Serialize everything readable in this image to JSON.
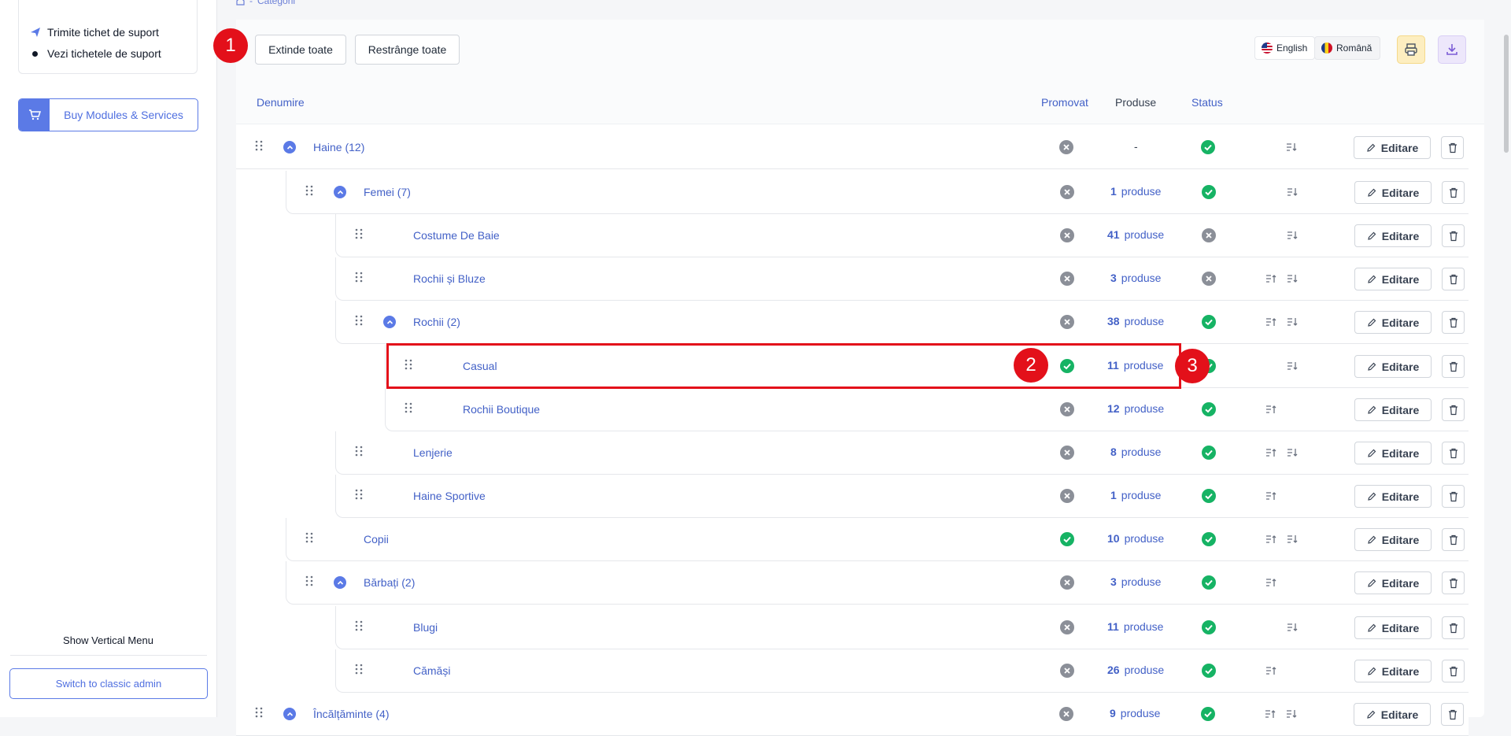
{
  "sidebar": {
    "support_send": "Trimite tichet de suport",
    "support_view": "Vezi tichetele de suport",
    "buy_label": "Buy Modules & Services",
    "show_vertical": "Show Vertical Menu",
    "classic_admin": "Switch to classic admin"
  },
  "breadcrumb": {
    "sep": "-",
    "current": "Categorii"
  },
  "toolbar": {
    "expand_all": "Extinde toate",
    "collapse_all": "Restrânge toate",
    "lang_en": "English",
    "lang_ro": "Română",
    "icons": [
      "printer-icon",
      "download-icon"
    ]
  },
  "table": {
    "headers": {
      "name": "Denumire",
      "promoted": "Promovat",
      "products": "Produse",
      "status": "Status"
    },
    "edit_label": "Editare",
    "products_word": "produse",
    "rows": [
      {
        "name": "Haine (12)",
        "promoted": false,
        "products": "-",
        "status": true,
        "sort": "down",
        "expand": true
      },
      {
        "name": "Femei (7)",
        "promoted": false,
        "products": "1",
        "status": true,
        "sort": "down",
        "expand": true
      },
      {
        "name": "Costume De Baie",
        "promoted": false,
        "products": "41",
        "status": false,
        "sort": "down",
        "expand": false
      },
      {
        "name": "Rochii și Bluze",
        "promoted": false,
        "products": "3",
        "status": false,
        "sort": "both",
        "expand": false
      },
      {
        "name": "Rochii (2)",
        "promoted": false,
        "products": "38",
        "status": true,
        "sort": "both",
        "expand": true
      },
      {
        "name": "Casual",
        "promoted": true,
        "products": "11",
        "status": true,
        "sort": "down",
        "expand": false
      },
      {
        "name": "Rochii Boutique",
        "promoted": false,
        "products": "12",
        "status": true,
        "sort": "up",
        "expand": false
      },
      {
        "name": "Lenjerie",
        "promoted": false,
        "products": "8",
        "status": true,
        "sort": "both",
        "expand": false
      },
      {
        "name": "Haine Sportive",
        "promoted": false,
        "products": "1",
        "status": true,
        "sort": "up",
        "expand": false
      },
      {
        "name": "Copii",
        "promoted": true,
        "products": "10",
        "status": true,
        "sort": "both",
        "expand": false
      },
      {
        "name": "Bărbați (2)",
        "promoted": false,
        "products": "3",
        "status": true,
        "sort": "up",
        "expand": true
      },
      {
        "name": "Blugi",
        "promoted": false,
        "products": "11",
        "status": true,
        "sort": "down",
        "expand": false
      },
      {
        "name": "Cămăși",
        "promoted": false,
        "products": "26",
        "status": true,
        "sort": "up",
        "expand": false
      },
      {
        "name": "Încălțăminte (4)",
        "promoted": false,
        "products": "9",
        "status": true,
        "sort": "both",
        "expand": true
      }
    ]
  },
  "annotations": [
    "1",
    "2",
    "3"
  ],
  "colors": {
    "accent": "#5b7ae6",
    "link": "#4361c7",
    "success": "#16b364",
    "muted": "#8b8f98",
    "highlight": "#e3101a"
  }
}
